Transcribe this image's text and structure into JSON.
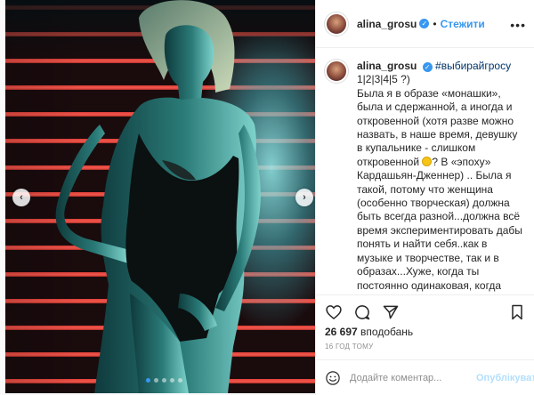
{
  "post": {
    "carousel": {
      "slide_count": 5,
      "active_slide": 1,
      "prev_label": "‹",
      "next_label": "›"
    }
  },
  "header": {
    "username": "alina_grosu",
    "separator": "•",
    "follow_label": "Стежити",
    "more_label": "•••"
  },
  "caption": {
    "username": "alina_grosu",
    "hashtag": "#выбирайгросу",
    "part1": "1|2|3|4|5 ?)\nБыла я в образе «монашки», была и сдержанной, а иногда и откровенной (хотя разве можно назвать, в наше время, девушку в купальнике - слишком откровенной ",
    "part2": "? В «эпоху» Кардашьян-Дженнер) .. Была я такой, потому что женщина (особенно творческая) должна быть всегда разной...должна всё время экспериментировать дабы понять и найти себя..как в музыке и творчестве, так и в образах...Хуже, когда ты постоянно одинаковая, когда повернуто все время оглядешься или прячешь своё тело от непринятия его... всё нужно в меру.. чтобы понять все свои грани, возможности и лучшие стороны."
  },
  "stats": {
    "likes_count": "26 697",
    "likes_label": "вподобань"
  },
  "time": "16 ГОД ТОМУ",
  "comment": {
    "placeholder": "Додайте коментар...",
    "publish_label": "Опублікувати"
  },
  "colors": {
    "accent": "#3897f0",
    "publish_disabled": "#b2dffc"
  }
}
